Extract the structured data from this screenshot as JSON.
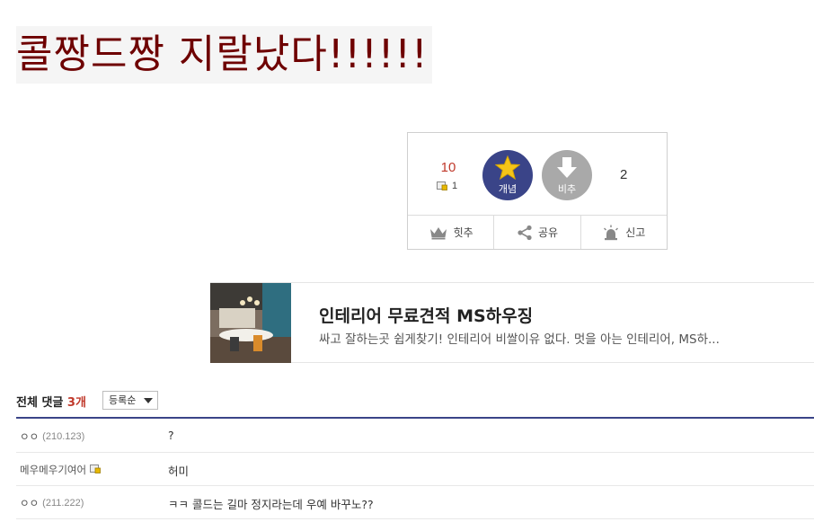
{
  "post": {
    "title": "콜짱드짱 지랄났다!!!!!!"
  },
  "vote": {
    "up_count": "10",
    "fix_count": "1",
    "up_label": "개념",
    "down_label": "비추",
    "down_count": "2",
    "actions": [
      {
        "label": "힛추",
        "icon": "crown-icon"
      },
      {
        "label": "공유",
        "icon": "share-icon"
      },
      {
        "label": "신고",
        "icon": "siren-icon"
      }
    ]
  },
  "ad": {
    "title": "인테리어 무료견적 MS하우징",
    "description": "싸고 잘하는곳 쉽게찾기! 인테리어 비쌀이유 없다. 멋을 아는 인테리어, MS하..."
  },
  "comments": {
    "label": "전체 댓글",
    "count": "3개",
    "sort": "등록순",
    "items": [
      {
        "nick": "ㅇㅇ",
        "ip": "(210.123)",
        "text": "?",
        "fixed": false
      },
      {
        "nick": "메우메우기여어",
        "ip": "",
        "text": "허미",
        "fixed": true
      },
      {
        "nick": "ㅇㅇ",
        "ip": "(211.222)",
        "text": "ㅋㅋ 콜드는 길마 정지라는데 우예 바꾸노??",
        "fixed": false
      }
    ]
  },
  "colors": {
    "title": "#6e0000",
    "up_button": "#3a4488",
    "down_button": "#a9a9a9",
    "accent_red": "#c0392b"
  }
}
